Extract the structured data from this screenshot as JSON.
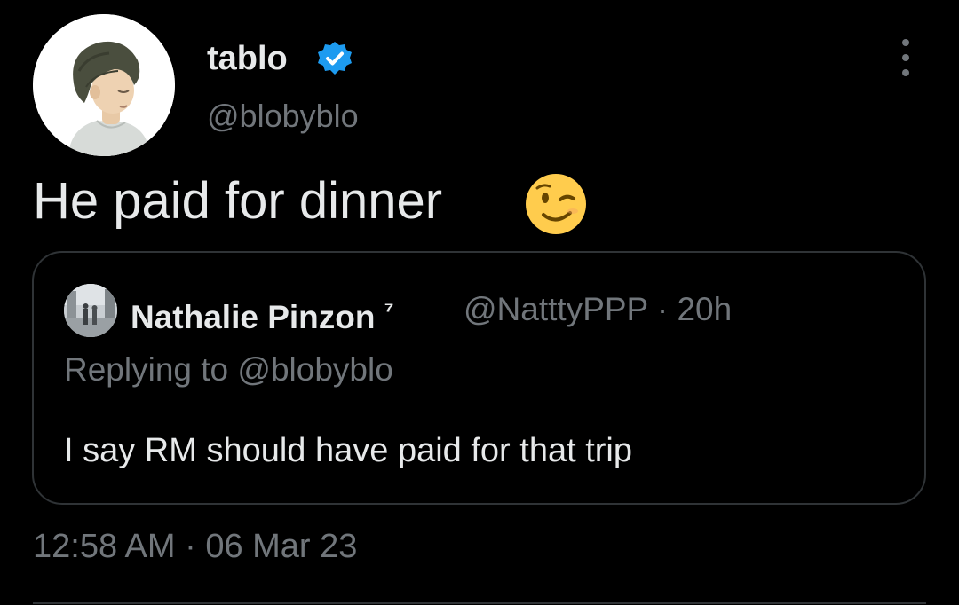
{
  "tweet": {
    "author": {
      "name": "tablo",
      "handle": "@blobyblo",
      "verified": true
    },
    "text": "He paid for dinner",
    "emoji": "winking-face-emoji",
    "timestamp": "12:58 AM · 06 Mar 23"
  },
  "quoted_tweet": {
    "author_name": "Nathalie Pinzon",
    "author_name_suffix": "⁷",
    "handle_time": "@NatttyPPP · 20h",
    "replying_to": "Replying to @blobyblo",
    "text": "I say RM should have paid for that trip"
  },
  "colors": {
    "background": "#000000",
    "primary_text": "#e7e9ea",
    "secondary_text": "#71767b",
    "border": "#2f3336",
    "verified_blue": "#1d9bf0",
    "emoji_yellow": "#ffcc4d"
  },
  "icons": {
    "verified": "verified-badge-icon",
    "more": "more-options-icon"
  }
}
